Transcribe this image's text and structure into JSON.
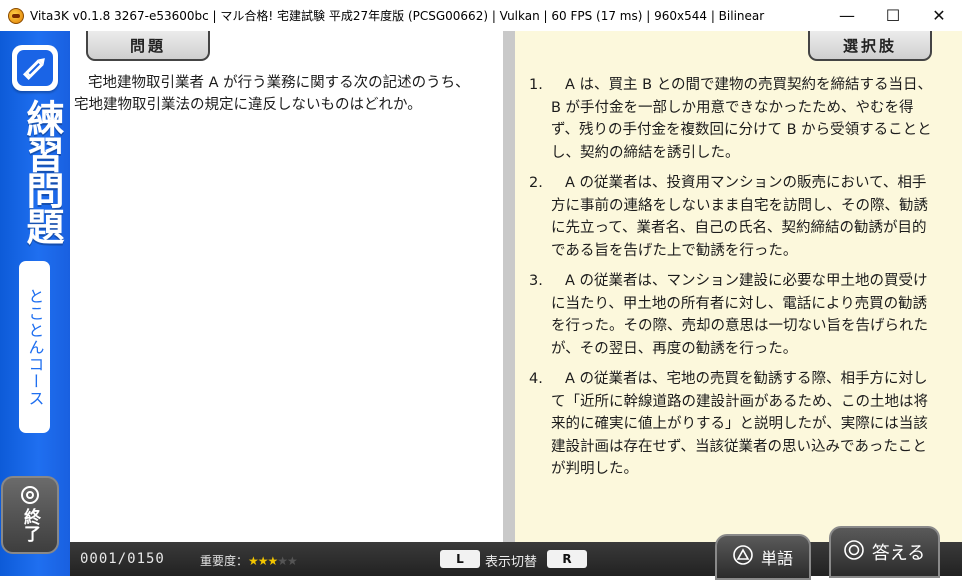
{
  "window": {
    "title": "Vita3K v0.1.8 3267-e53600bc | マル合格! 宅建試験 平成27年度版 (PCSG00662) | Vulkan | 60 FPS (17 ms) | 960x544 | Bilinear",
    "minimize": "—",
    "maximize": "☐",
    "close": "✕"
  },
  "sidebar": {
    "title": "練習問題",
    "course": "とことんコース",
    "exit_label": "終了"
  },
  "question": {
    "tab_label": "問題",
    "line1": "宅地建物取引業者 A が行う業務に関する次の記述のうち、",
    "line2": "宅地建物取引業法の規定に違反しないものはどれか。"
  },
  "choices": {
    "tab_label": "選択肢",
    "items": [
      {
        "num": "1.",
        "text": "A は、買主 B との間で建物の売買契約を締結する当日、B が手付金を一部しか用意できなかったため、やむを得ず、残りの手付金を複数回に分けて B から受領することとし、契約の締結を誘引した。"
      },
      {
        "num": "2.",
        "text": "A の従業者は、投資用マンションの販売において、相手方に事前の連絡をしないまま自宅を訪問し、その際、勧誘に先立って、業者名、自己の氏名、契約締結の勧誘が目的である旨を告げた上で勧誘を行った。"
      },
      {
        "num": "3.",
        "text": "A の従業者は、マンション建設に必要な甲土地の買受けに当たり、甲土地の所有者に対し、電話により売買の勧誘を行った。その際、売却の意思は一切ない旨を告げられたが、その翌日、再度の勧誘を行った。"
      },
      {
        "num": "4.",
        "text": "A の従業者は、宅地の売買を勧誘する際、相手方に対して「近所に幹線道路の建設計画があるため、この土地は将来的に確実に値上がりする」と説明したが、実際には当該建設計画は存在せず、当該従業者の思い込みであったことが判明した。"
      }
    ]
  },
  "bottom": {
    "progress": "0001/0150",
    "importance_label": "重要度：",
    "stars_on": "★★★",
    "stars_off": "★★",
    "importance_value": 3,
    "importance_max": 5,
    "key_l": "L",
    "toggle_label": "表示切替",
    "key_r": "R",
    "word_button": "単語",
    "answer_button": "答える"
  },
  "colors": {
    "sidebar_blue": "#1f6ff0",
    "choices_bg": "#fcf8dc",
    "star": "#f2c500"
  }
}
